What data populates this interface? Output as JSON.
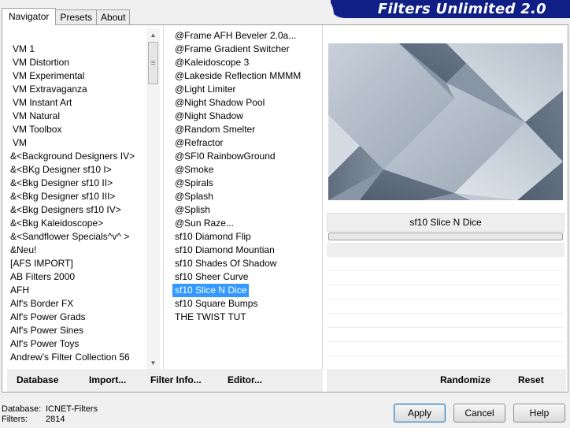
{
  "app": {
    "title": "Filters Unlimited 2.0"
  },
  "tabs": [
    {
      "label": "Navigator",
      "active": true
    },
    {
      "label": "Presets",
      "active": false
    },
    {
      "label": "About",
      "active": false
    }
  ],
  "categories": [
    "VM 1",
    "VM Distortion",
    "VM Experimental",
    "VM Extravaganza",
    "VM Instant Art",
    "VM Natural",
    "VM Toolbox",
    "VM",
    "&<Background Designers IV>",
    "&<BKg Designer sf10 I>",
    "&<Bkg Designer sf10 II>",
    "&<Bkg Designer sf10 III>",
    "&<Bkg Designers sf10 IV>",
    "&<Bkg Kaleidoscope>",
    "&<Sandflower Specials^v^ >",
    "&Neu!",
    "[AFS IMPORT]",
    "AB Filters 2000",
    "AFH",
    "Alf's Border FX",
    "Alf's Power Grads",
    "Alf's Power Sines",
    "Alf's Power Toys",
    "Andrew's Filter Collection 56"
  ],
  "filters": [
    "@Frame AFH Beveler 2.0a...",
    "@Frame Gradient Switcher",
    "@Kaleidoscope 3",
    "@Lakeside Reflection MMMM",
    "@Light Limiter",
    "@Night Shadow Pool",
    "@Night Shadow",
    "@Random Smelter",
    "@Refractor",
    "@SFI0 RainbowGround",
    "@Smoke",
    "@Spirals",
    "@Splash",
    "@Splish",
    "@Sun Raze...",
    "sf10 Diamond Flip",
    "sf10 Diamond Mountian",
    "sf10 Shades Of Shadow",
    "sf10 Sheer Curve",
    "sf10 Slice N Dice",
    "sf10 Square Bumps",
    "THE TWIST TUT"
  ],
  "selected_filter": "sf10 Slice N Dice",
  "preview": {
    "label": "sf10 Slice N Dice"
  },
  "toolbar": {
    "database": "Database",
    "import": "Import...",
    "filter_info": "Filter Info...",
    "editor": "Editor...",
    "randomize": "Randomize",
    "reset": "Reset"
  },
  "footer": {
    "database_label": "Database:",
    "database_value": "ICNET-Filters",
    "filters_label": "Filters:",
    "filters_value": "2814",
    "apply": "Apply",
    "cancel": "Cancel",
    "help": "Help"
  },
  "colors": {
    "banner": "#0f1f86",
    "selection": "#3399ff"
  },
  "icons": {
    "scroll_up": "scroll-up-arrow-icon",
    "scroll_down": "scroll-down-arrow-icon"
  }
}
